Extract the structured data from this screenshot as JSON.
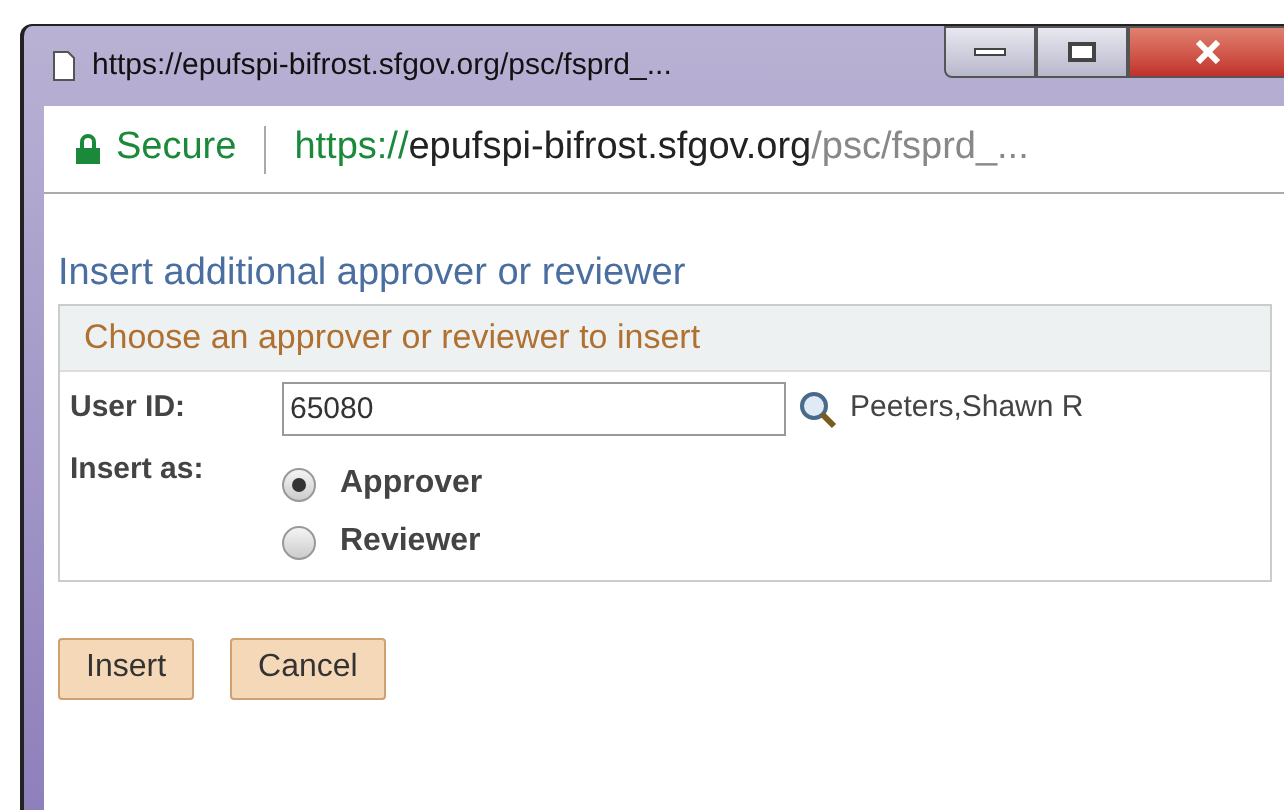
{
  "window": {
    "title": "https://epufspi-bifrost.sfgov.org/psc/fsprd_..."
  },
  "address_bar": {
    "security": "Secure",
    "url_scheme": "https://",
    "url_host": "epufspi-bifrost.sfgov.org",
    "url_path": "/psc/fsprd_..."
  },
  "page": {
    "heading": "Insert additional approver or reviewer",
    "section_title": "Choose an approver or reviewer to insert",
    "user_id": {
      "label": "User ID:",
      "value": "65080",
      "name": "Peeters,Shawn R"
    },
    "insert_as": {
      "label": "Insert as:",
      "options": [
        {
          "label": "Approver",
          "selected": true
        },
        {
          "label": "Reviewer",
          "selected": false
        }
      ]
    }
  },
  "buttons": [
    "Insert",
    "Cancel"
  ]
}
